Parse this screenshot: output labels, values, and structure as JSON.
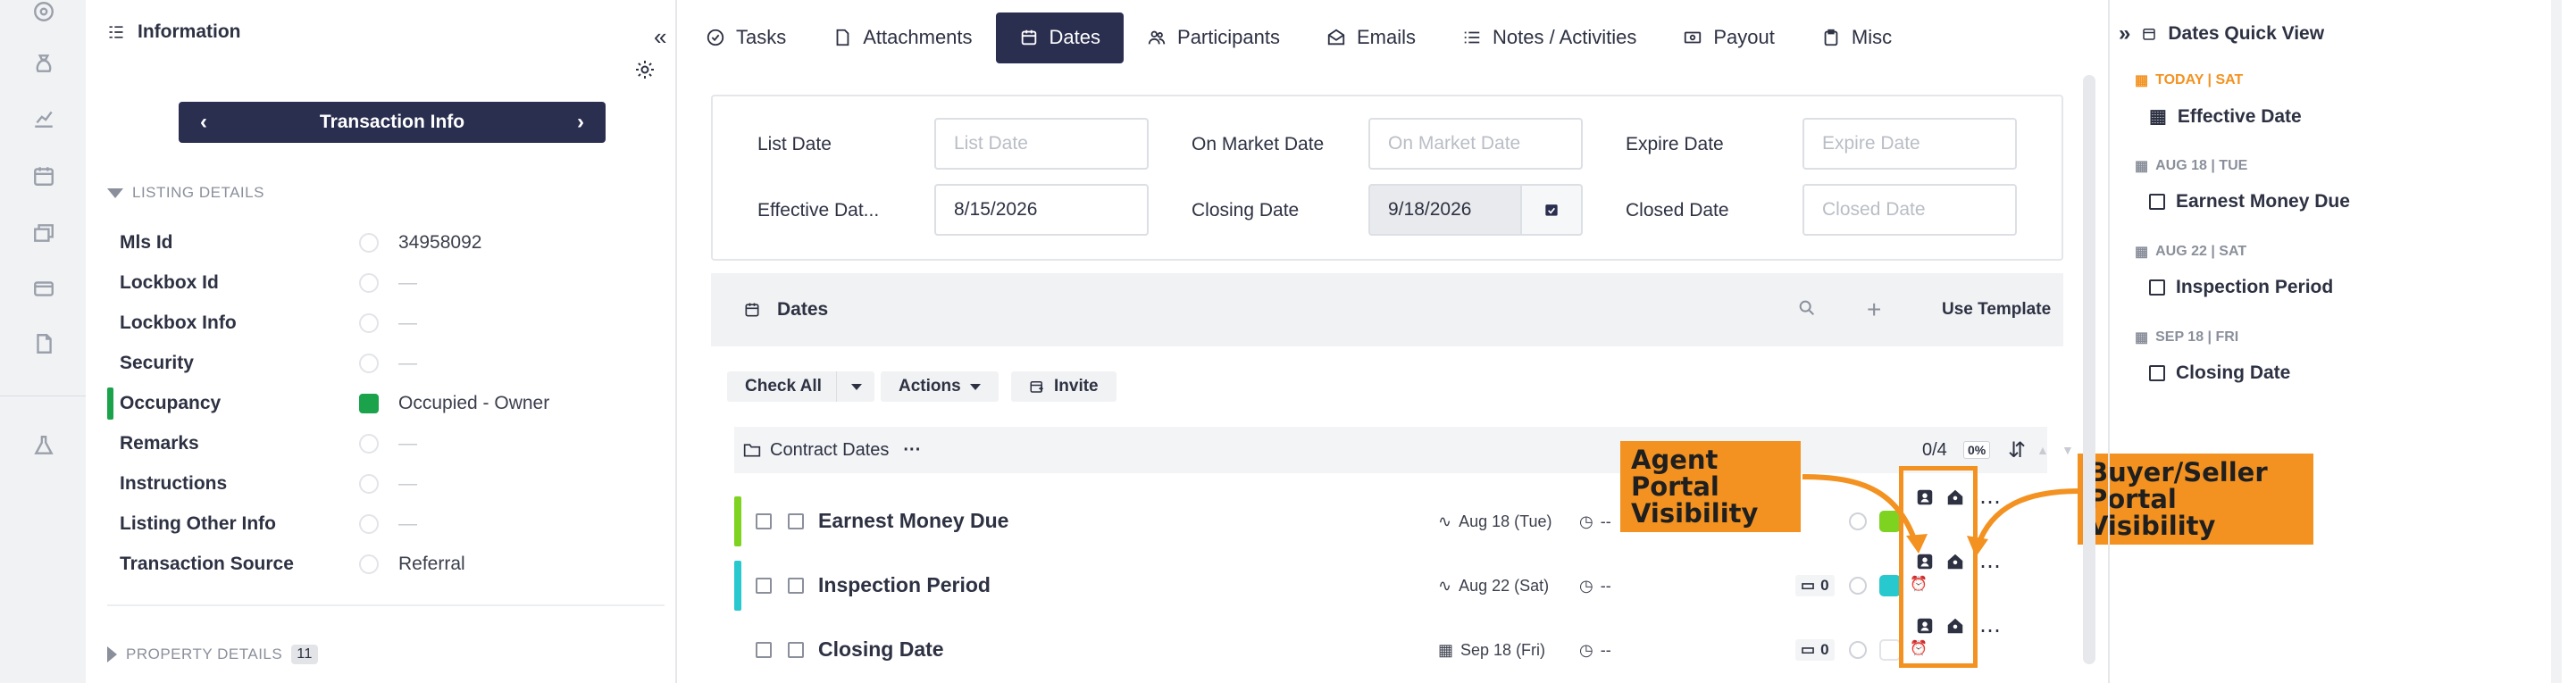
{
  "left_panel": {
    "title": "Information",
    "nav_title": "Transaction Info",
    "listing_section": "LISTING DETAILS",
    "property_section": "PROPERTY DETAILS",
    "property_count": "11",
    "fields": [
      {
        "label": "Mls Id",
        "value": "34958092"
      },
      {
        "label": "Lockbox Id",
        "value": "—"
      },
      {
        "label": "Lockbox Info",
        "value": "—"
      },
      {
        "label": "Security",
        "value": "—"
      },
      {
        "label": "Occupancy",
        "value": "Occupied - Owner"
      },
      {
        "label": "Remarks",
        "value": "—"
      },
      {
        "label": "Instructions",
        "value": "—"
      },
      {
        "label": "Listing Other Info",
        "value": "—"
      },
      {
        "label": "Transaction Source",
        "value": "Referral"
      }
    ]
  },
  "tabs": [
    {
      "label": "Tasks",
      "icon": "check-circle-icon"
    },
    {
      "label": "Attachments",
      "icon": "file-icon"
    },
    {
      "label": "Dates",
      "icon": "calendar-icon",
      "active": true
    },
    {
      "label": "Participants",
      "icon": "people-icon"
    },
    {
      "label": "Emails",
      "icon": "envelope-icon"
    },
    {
      "label": "Notes / Activities",
      "icon": "list-icon"
    },
    {
      "label": "Payout",
      "icon": "money-icon"
    },
    {
      "label": "Misc",
      "icon": "clipboard-icon"
    }
  ],
  "date_fields": {
    "list_date": {
      "label": "List Date",
      "placeholder": "List Date",
      "value": ""
    },
    "on_market_date": {
      "label": "On Market Date",
      "placeholder": "On Market Date",
      "value": ""
    },
    "expire_date": {
      "label": "Expire Date",
      "placeholder": "Expire Date",
      "value": ""
    },
    "effective_date": {
      "label": "Effective Dat...",
      "value": "8/15/2026"
    },
    "closing_date": {
      "label": "Closing Date",
      "value": "9/18/2026"
    },
    "closed_date": {
      "label": "Closed Date",
      "placeholder": "Closed Date",
      "value": ""
    }
  },
  "dates_section": {
    "title": "Dates",
    "use_template": "Use Template",
    "check_all": "Check All",
    "actions": "Actions",
    "invite": "Invite",
    "group_name": "Contract Dates",
    "group_more": "···",
    "progress_count": "0/4",
    "progress_pct": "0%",
    "tasks": [
      {
        "name": "Earnest Money Due",
        "due": "Aug 18 (Tue)",
        "time": "--",
        "bar_color": "#7ed321",
        "status_color": "#7ed321"
      },
      {
        "name": "Inspection Period",
        "due": "Aug 22 (Sat)",
        "time": "--",
        "comments": "0",
        "bar_color": "#28c8cf",
        "status_color": "#28c8cf"
      },
      {
        "name": "Closing Date",
        "due": "Sep 18 (Fri)",
        "time": "--",
        "comments": "0",
        "bar_color": "",
        "status_color": "#ffffff"
      }
    ]
  },
  "annotations": {
    "agent": "Agent Portal\nVisibility",
    "buyer": "Buyer/Seller\nPortal Visibility",
    "color": "#f39221"
  },
  "quick_view": {
    "title": "Dates Quick View",
    "days": [
      {
        "day": "TODAY | SAT",
        "item": "Effective Date",
        "today": true
      },
      {
        "day": "AUG 18 | TUE",
        "item": "Earnest Money Due"
      },
      {
        "day": "AUG 22 | SAT",
        "item": "Inspection Period"
      },
      {
        "day": "SEP 18 | FRI",
        "item": "Closing Date"
      }
    ]
  }
}
